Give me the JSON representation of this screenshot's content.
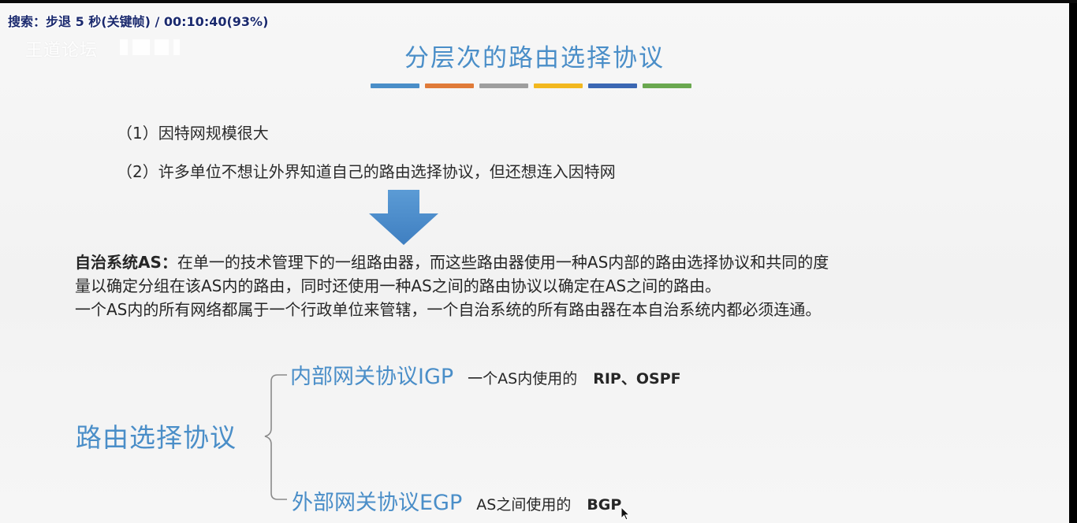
{
  "player": {
    "seek_overlay": "搜索：步退 5 秒(关键帧) / 00:10:40(93%)",
    "watermark": "王道论坛"
  },
  "slide": {
    "title": "分层次的路由选择协议",
    "title_color": "#4a8ec8",
    "divider_colors": [
      "#4a8ec8",
      "#e07b39",
      "#9e9e9e",
      "#f2b81f",
      "#3b67b3",
      "#6aa84f"
    ],
    "points": [
      "（1）因特网规模很大",
      "（2）许多单位不想让外界知道自己的路由选择协议，但还想连入因特网"
    ],
    "as_definition": {
      "label": "自治系统AS：",
      "line1_rest": "在单一的技术管理下的一组路由器，而这些路由器使用一种AS内部的路由选择协议和共同的度",
      "line2": "量以确定分组在该AS内的路由，同时还使用一种AS之间的路由协议以确定在AS之间的路由。",
      "line3": "一个AS内的所有网络都属于一个行政单位来管辖，一个自治系统的所有路由器在本自治系统内都必须连通。"
    },
    "routing": {
      "label": "路由选择协议",
      "igp": {
        "name": "内部网关协议IGP",
        "desc": "一个AS内使用的",
        "protocols": "RIP、OSPF"
      },
      "egp": {
        "name": "外部网关协议EGP",
        "desc": "AS之间使用的",
        "protocols": "BGP"
      }
    }
  }
}
